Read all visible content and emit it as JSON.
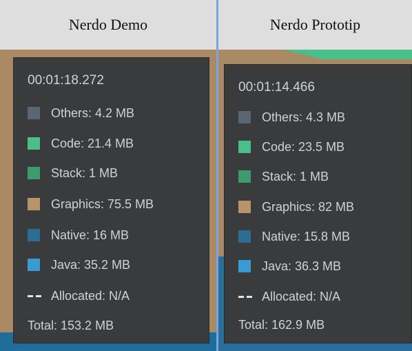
{
  "columns": [
    {
      "title": "Nerdo Demo",
      "tooltip": {
        "timestamp": "00:01:18.272",
        "rows": [
          {
            "label": "Others: 4.2 MB",
            "color": "#5a6772"
          },
          {
            "label": "Code: 21.4 MB",
            "color": "#4bbf8a"
          },
          {
            "label": "Stack: 1 MB",
            "color": "#3e9b6d"
          },
          {
            "label": "Graphics: 75.5 MB",
            "color": "#b8946a"
          },
          {
            "label": "Native: 16 MB",
            "color": "#2c6e93"
          },
          {
            "label": "Java: 35.2 MB",
            "color": "#3a9bd3"
          }
        ],
        "allocated": "Allocated: N/A",
        "total": "Total: 153.2 MB"
      }
    },
    {
      "title": "Nerdo Prototip",
      "tooltip": {
        "timestamp": "00:01:14.466",
        "rows": [
          {
            "label": "Others: 4.3 MB",
            "color": "#5a6772"
          },
          {
            "label": "Code: 23.5 MB",
            "color": "#4bbf8a"
          },
          {
            "label": "Stack: 1 MB",
            "color": "#3e9b6d"
          },
          {
            "label": "Graphics: 82 MB",
            "color": "#b8946a"
          },
          {
            "label": "Native: 15.8 MB",
            "color": "#2c6e93"
          },
          {
            "label": "Java: 36.3 MB",
            "color": "#3a9bd3"
          }
        ],
        "allocated": "Allocated: N/A",
        "total": "Total: 162.9 MB"
      }
    }
  ],
  "colors": {
    "header_bg": "#dedede",
    "divider": "#79a6df",
    "tooltip_bg": "#3a3b3d",
    "graphics_band": "#a98a64",
    "native_band": "#2c5d80",
    "code_band": "#4bbf8a"
  }
}
